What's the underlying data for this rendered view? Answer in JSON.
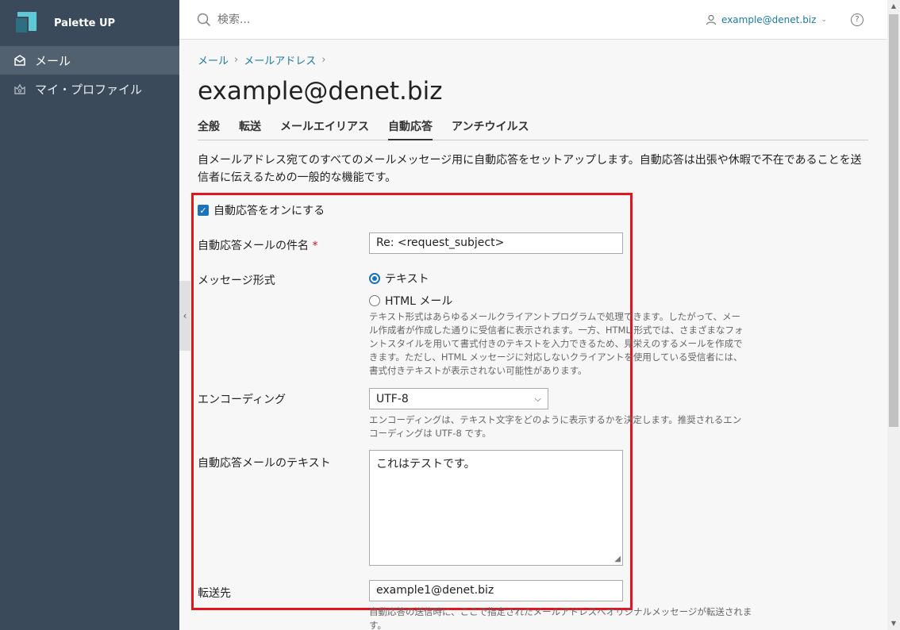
{
  "brand": {
    "name": "Palette UP"
  },
  "sidebar": {
    "items": [
      {
        "label": "メール",
        "icon": "mail-icon",
        "active": true
      },
      {
        "label": "マイ・プロファイル",
        "icon": "profile-icon",
        "active": false
      }
    ]
  },
  "header": {
    "search_placeholder": "検索...",
    "user": "example@denet.biz",
    "help": "?"
  },
  "breadcrumb": [
    "メール",
    "メールアドレス"
  ],
  "page_title": "example@denet.biz",
  "tabs": [
    {
      "label": "全般",
      "active": false
    },
    {
      "label": "転送",
      "active": false
    },
    {
      "label": "メールエイリアス",
      "active": false
    },
    {
      "label": "自動応答",
      "active": true
    },
    {
      "label": "アンチウイルス",
      "active": false
    }
  ],
  "description": "自メールアドレス宛てのすべてのメールメッセージ用に自動応答をセットアップします。自動応答は出張や休暇で不在であることを送信者に伝えるための一般的な機能です。",
  "form": {
    "enable_label": "自動応答をオンにする",
    "enabled": true,
    "subject_label": "自動応答メールの件名",
    "subject_required": "*",
    "subject_value": "Re: <request_subject>",
    "format_label": "メッセージ形式",
    "format_options": [
      {
        "label": "テキスト",
        "selected": true
      },
      {
        "label": "HTML メール",
        "selected": false
      }
    ],
    "format_help": [
      "テキスト形式はあらゆるメールクライアントプログラムで処理できます。したがって、メー",
      "ル作成者が作成した通りに受信者に表示されます。一方、HTML 形式では、さまざまなフォ",
      "ントスタイルを用いて書式付きのテキストを入力できるため、見栄えのするメールを作成で",
      "きます。ただし、HTML メッセージに対応しないクライアントを使用している受信者には、",
      "書式付きテキストが表示されない可能性があります。"
    ],
    "encoding_label": "エンコーディング",
    "encoding_value": "UTF-8",
    "encoding_help": [
      "エンコーディングは、テキスト文字をどのように表示するかを決定します。推奨されるエン",
      "コーディングは UTF-8 です。"
    ],
    "text_label": "自動応答メールのテキスト",
    "text_value": "これはテストです。",
    "forward_label": "転送先",
    "forward_value": "example1@denet.biz",
    "forward_help": [
      "自動応答の送信時に、ここで指定されたメールアドレスへオリジナルメッセージが転送されま",
      "す。"
    ]
  },
  "colors": {
    "sidebar": "#3b4a5a",
    "accent": "#1a73b8",
    "highlight": "#e3131f",
    "link": "#1d7aa3"
  }
}
